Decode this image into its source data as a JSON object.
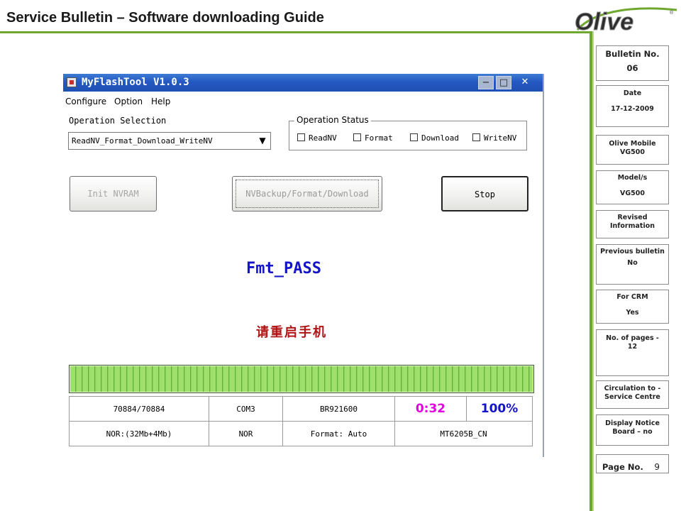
{
  "slide": {
    "title": "Service Bulletin – Software downloading Guide",
    "logo_text": "Olive",
    "accent_color": "#6fa82e"
  },
  "sidebar": {
    "bulletin": {
      "label": "Bulletin No.",
      "value": "06"
    },
    "date": {
      "label": "Date",
      "value": "17-12-2009"
    },
    "olive_mobile": {
      "label": "Olive Mobile VG500"
    },
    "model": {
      "label": "Model/s",
      "value": "VG500"
    },
    "revised": {
      "label": "Revised Information"
    },
    "previous": {
      "label": "Previous bulletin",
      "value": "No"
    },
    "crm": {
      "label": "For CRM",
      "value": "Yes"
    },
    "pages": {
      "label": "No. of pages - 12"
    },
    "circulation": {
      "label": "Circulation to - Service Centre"
    },
    "display": {
      "label": "Display Notice Board – no"
    },
    "page_no": {
      "label": "Page No.",
      "value": "9"
    }
  },
  "app": {
    "title": "MyFlashTool V1.0.3",
    "menu": [
      "Configure",
      "Option",
      "Help"
    ],
    "operation_selection_label": "Operation Selection",
    "operation_selection_value": "ReadNV_Format_Download_WriteNV",
    "operation_status_label": "Operation Status",
    "status_checkboxes": [
      "ReadNV",
      "Format",
      "Download",
      "WriteNV"
    ],
    "buttons": {
      "init": "Init NVRAM",
      "main": "NVBackup/Format/Download",
      "stop": "Stop"
    },
    "result_text": "Fmt_PASS",
    "result_cn": "请重启手机",
    "progress_percent": 100,
    "info_row1": [
      "70884/70884",
      "COM3",
      "BR921600",
      "0:32",
      "100%"
    ],
    "info_row2": [
      "NOR:(32Mb+4Mb)",
      "NOR",
      "Format: Auto",
      "MT6205B_CN"
    ]
  }
}
